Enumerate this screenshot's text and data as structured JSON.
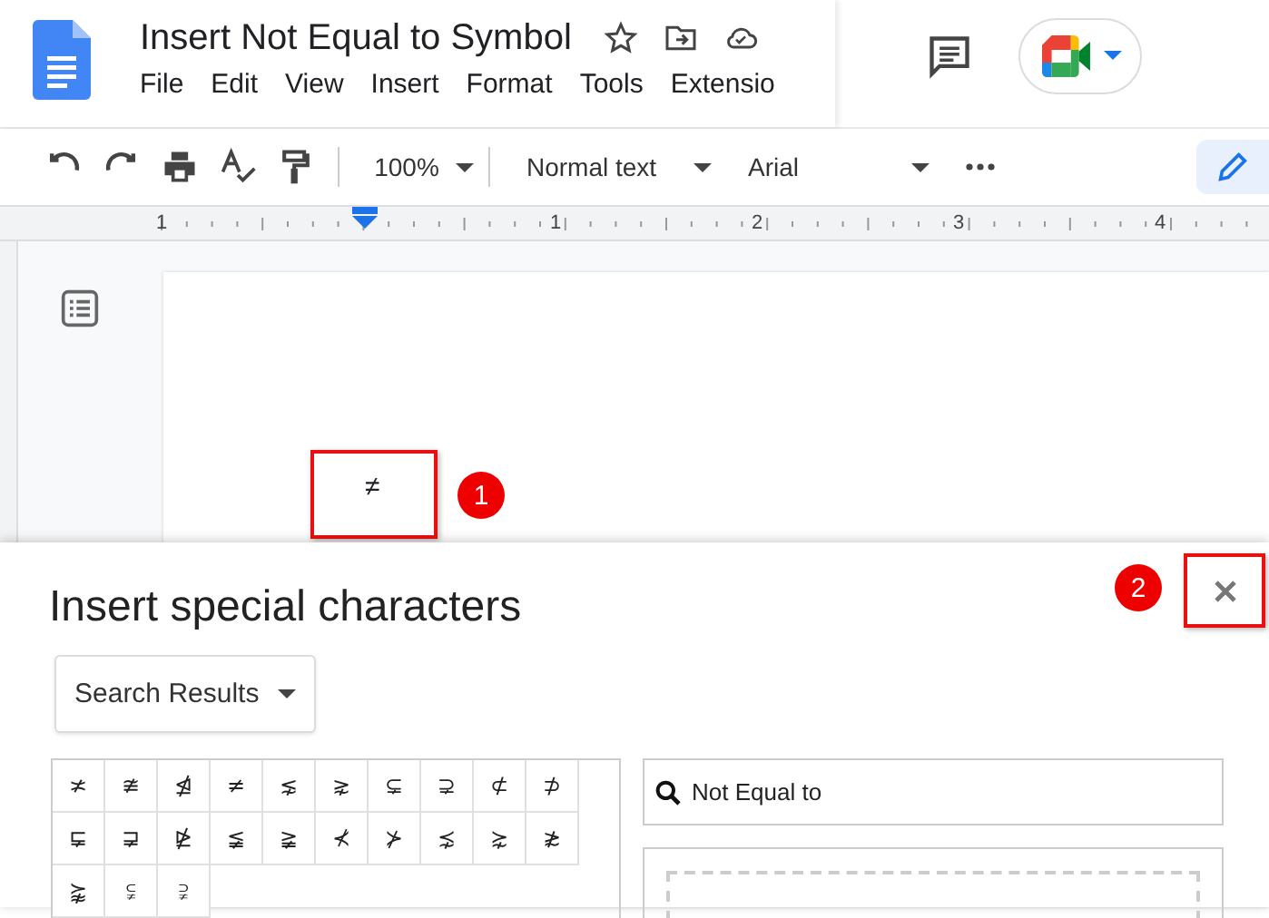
{
  "document": {
    "title": "Insert Not Equal to Symbol",
    "menu": [
      "File",
      "Edit",
      "View",
      "Insert",
      "Format",
      "Tools",
      "Extensio"
    ]
  },
  "toolbar": {
    "zoom": "100%",
    "style": "Normal text",
    "font": "Arial"
  },
  "ruler": [
    "1",
    "1",
    "2",
    "3",
    "4"
  ],
  "page": {
    "text": "≠"
  },
  "annotations": [
    {
      "label": "1"
    },
    {
      "label": "2"
    }
  ],
  "dialog": {
    "title": "Insert special characters",
    "category": "Search Results",
    "characters": [
      "≭",
      "≇",
      "⋬",
      "≠",
      "⋦",
      "⋧",
      "⊊",
      "⊋",
      "⊄",
      "⊅",
      "⋤",
      "⋥",
      "⋭",
      "≨",
      "≩",
      "⊀",
      "⊁",
      "⋨",
      "⋩",
      "≵",
      "⪺",
      "⫋",
      "⫌"
    ],
    "search": {
      "value": "Not Equal to"
    }
  }
}
